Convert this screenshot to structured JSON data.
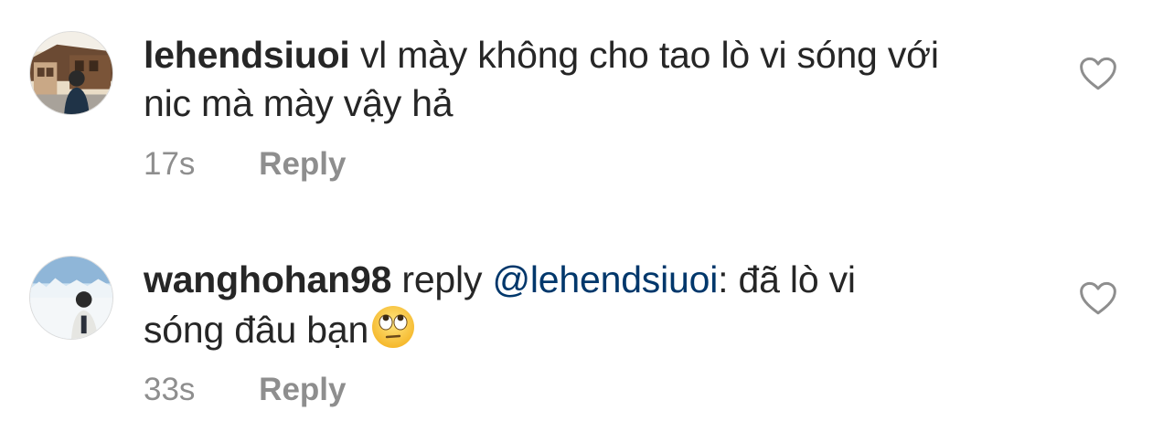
{
  "comments": [
    {
      "username": "lehendsiuoi",
      "prefix": "",
      "mention": "",
      "text": "vl mày không cho tao lò vi sóng với nic mà mày vậy hả",
      "text_line1": "vl mày không cho tao lò vi sóng với",
      "text_line2": "nic mà mày vậy hả",
      "time": "17s",
      "reply_label": "Reply",
      "avatar_icon": "profile-photo-building-street",
      "like_icon": "heart-outline-icon"
    },
    {
      "username": "wanghohan98",
      "prefix": "reply",
      "mention": "@lehendsiuoi",
      "mention_suffix": ":",
      "text_line1": "đã lò vi",
      "text_line2": "sóng đâu bạn",
      "emoji": "face-with-rolling-eyes",
      "time": "33s",
      "reply_label": "Reply",
      "avatar_icon": "profile-photo-snow-landscape",
      "like_icon": "heart-outline-icon"
    }
  ],
  "colors": {
    "text": "#262626",
    "meta": "#8e8e8e",
    "mention": "#00376b"
  }
}
